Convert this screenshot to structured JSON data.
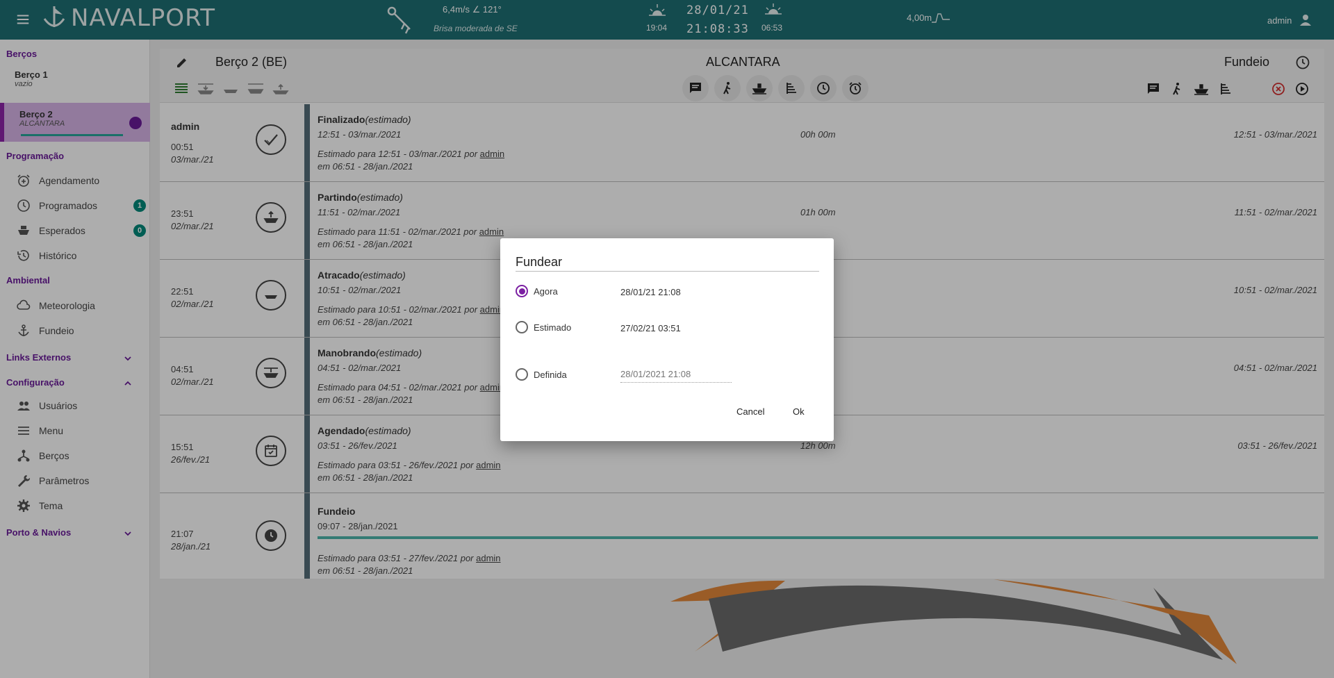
{
  "header": {
    "app_name": "NAVALPORT",
    "wind_speed": "6,4m/s ∠ 121°",
    "wind_desc": "Brisa moderada de SE",
    "sunset_time": "19:04",
    "date": "28/01/21",
    "clock": "21:08:33",
    "sunrise_time": "06:53",
    "tide": "4,00m",
    "user": "admin"
  },
  "sidebar": {
    "berths_title": "Berços",
    "berth1": {
      "name": "Berço 1",
      "sub": "vazio"
    },
    "berth2": {
      "name": "Berço 2",
      "sub": "ALCANTARA"
    },
    "programacao_title": "Programação",
    "programacao_items": [
      {
        "label": "Agendamento"
      },
      {
        "label": "Programados",
        "badge": "1"
      },
      {
        "label": "Esperados",
        "badge": "0"
      },
      {
        "label": "Histórico"
      }
    ],
    "ambiental_title": "Ambiental",
    "ambiental_items": [
      {
        "label": "Meteorologia"
      },
      {
        "label": "Fundeio"
      }
    ],
    "links_title": "Links Externos",
    "config_title": "Configuração",
    "config_items": [
      {
        "label": "Usuários"
      },
      {
        "label": "Menu"
      },
      {
        "label": "Berços"
      },
      {
        "label": "Parâmetros"
      },
      {
        "label": "Tema"
      }
    ],
    "porto_title": "Porto & Navios"
  },
  "panel": {
    "berth_title": "Berço 2 (BE)",
    "place_title": "ALCANTARA",
    "state_title": "Fundeio"
  },
  "events": [
    {
      "user": "admin",
      "t1": "00:51",
      "t2": "03/mar./21",
      "title": "Finalizado",
      "tag": "(estimado)",
      "time": "12:51 - 03/mar./2021",
      "duration": "00h 00m",
      "right": "12:51 - 03/mar./2021",
      "est": "Estimado para 12:51 - 03/mar./2021 por ",
      "by": "admin",
      "on": "em 06:51 - 28/jan./2021"
    },
    {
      "user": "",
      "t1": "23:51",
      "t2": "02/mar./21",
      "title": "Partindo",
      "tag": "(estimado)",
      "time": "11:51 - 02/mar./2021",
      "duration": "01h 00m",
      "right": "11:51 - 02/mar./2021",
      "est": "Estimado para 11:51 - 02/mar./2021 por ",
      "by": "admin",
      "on": "em 06:51 - 28/jan./2021"
    },
    {
      "user": "",
      "t1": "22:51",
      "t2": "02/mar./21",
      "title": "Atracado",
      "tag": "(estimado)",
      "time": "10:51 - 02/mar./2021",
      "duration": "",
      "right": "10:51 - 02/mar./2021",
      "est": "Estimado para 10:51 - 02/mar./2021 por ",
      "by": "admin",
      "on": "em 06:51 - 28/jan./2021"
    },
    {
      "user": "",
      "t1": "04:51",
      "t2": "02/mar./21",
      "title": "Manobrando",
      "tag": "(estimado)",
      "time": "04:51 - 02/mar./2021",
      "duration": "",
      "right": "04:51 - 02/mar./2021",
      "est": "Estimado para 04:51 - 02/mar./2021 por ",
      "by": "admin",
      "on": "em 06:51 - 28/jan./2021"
    },
    {
      "user": "",
      "t1": "15:51",
      "t2": "26/fev./21",
      "title": "Agendado",
      "tag": "(estimado)",
      "time": "03:51 - 26/fev./2021",
      "duration": "12h 00m",
      "right": "03:51 - 26/fev./2021",
      "est": "Estimado para 03:51 - 26/fev./2021 por ",
      "by": "admin",
      "on": "em 06:51 - 28/jan./2021"
    },
    {
      "user": "",
      "t1": "21:07",
      "t2": "28/jan./21",
      "title": "Fundeio",
      "tag": "",
      "time": "09:07 - 28/jan./2021",
      "duration": "",
      "right": "",
      "est": "Estimado para 03:51 - 27/fev./2021 por ",
      "by": "admin",
      "on": "em 06:51 - 28/jan./2021"
    }
  ],
  "dialog": {
    "title": "Fundear",
    "options": [
      {
        "label": "Agora",
        "value": "28/01/21 21:08",
        "selected": true
      },
      {
        "label": "Estimado",
        "value": "27/02/21 03:51",
        "selected": false
      },
      {
        "label": "Definida",
        "value": "",
        "selected": false
      }
    ],
    "defined_placeholder": "28/01/2021 21:08",
    "cancel_label": "Cancel",
    "ok_label": "Ok"
  },
  "colors": {
    "topbar": "#1e6f73",
    "accent": "#6a1b9a",
    "badge": "#00897b",
    "progress": "#4db6ac"
  }
}
